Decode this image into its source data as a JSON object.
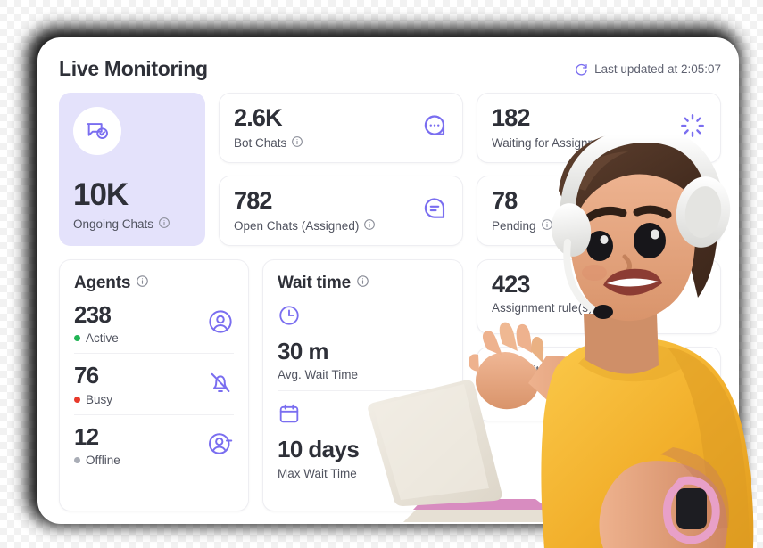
{
  "header": {
    "title": "Live Monitoring",
    "refresh_icon": "refresh-icon",
    "last_updated": "Last updated at 2:05:07"
  },
  "hero": {
    "icon": "chat-check-icon",
    "value": "10K",
    "label": "Ongoing Chats",
    "info_icon": "info-icon"
  },
  "stats": [
    {
      "value": "2.6K",
      "label": "Bot Chats",
      "icon": "chat-dots-icon",
      "info_icon": "info-icon"
    },
    {
      "value": "782",
      "label": "Open Chats (Assigned)",
      "icon": "chat-lines-icon",
      "info_icon": "info-icon"
    },
    {
      "value": "182",
      "label": "Waiting for Assignment",
      "icon": "spinner-icon",
      "info_icon": "info-icon"
    },
    {
      "value": "78",
      "label": "Pending",
      "icon": "clock-dashed-icon",
      "info_icon": "info-icon"
    }
  ],
  "agents": {
    "title": "Agents",
    "info_icon": "info-icon",
    "rows": [
      {
        "count": "238",
        "status": "Active",
        "dot_color": "#22b455",
        "icon": "user-circle-icon"
      },
      {
        "count": "76",
        "status": "Busy",
        "dot_color": "#e8392b",
        "icon": "bell-off-icon"
      },
      {
        "count": "12",
        "status": "Offline",
        "dot_color": "#a9adb6",
        "icon": "user-minus-icon"
      }
    ]
  },
  "wait_time": {
    "title": "Wait time",
    "info_icon": "info-icon",
    "blocks": [
      {
        "icon": "clock-icon",
        "value": "30 m",
        "label": "Avg. Wait Time"
      },
      {
        "icon": "calendar-icon",
        "value": "10 days",
        "label": "Max Wait Time"
      }
    ]
  },
  "right_cards": [
    {
      "value": "423",
      "label": "Assignment rule(s)"
    },
    {
      "value": "",
      "label": "Avg Waiting Resp"
    }
  ],
  "colors": {
    "accent_purple": "#7a6ef0",
    "hero_bg": "#e4e2fb",
    "text_dark": "#2e3038",
    "text_muted": "#50535f",
    "card_border": "#eeeef2"
  },
  "artwork": {
    "name": "support-agent-3d-illustration",
    "shirt_color": "#f0b429",
    "skin_color": "#e3a07a",
    "hair_color": "#4b3226",
    "headphone_color": "#f2f2f0",
    "laptop_color": "#ece8e0",
    "laptop_accent": "#d98cc0",
    "watch_color": "#e8a0c8"
  }
}
